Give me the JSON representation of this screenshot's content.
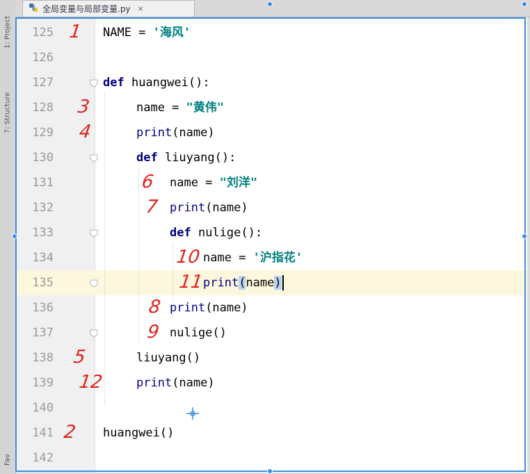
{
  "sidebar": {
    "project_tab": "1: Project",
    "structure_tab": "7: Structure",
    "favorites_tab": "Fav"
  },
  "tab": {
    "filename": "全局变量与局部变量.py",
    "close": "×"
  },
  "lines": [
    {
      "num": "125",
      "indent": 0,
      "parts": [
        [
          "NAME = ",
          "p"
        ],
        [
          "'海风'",
          "s"
        ]
      ],
      "anno": "1"
    },
    {
      "num": "126",
      "indent": 0,
      "parts": []
    },
    {
      "num": "127",
      "indent": 0,
      "parts": [
        [
          "def ",
          "k"
        ],
        [
          "huangwei",
          "p"
        ],
        [
          "():",
          "p"
        ]
      ],
      "fold": true
    },
    {
      "num": "128",
      "indent": 1,
      "parts": [
        [
          "name = ",
          "p"
        ],
        [
          "\"黄伟\"",
          "s"
        ]
      ],
      "anno": "3"
    },
    {
      "num": "129",
      "indent": 1,
      "parts": [
        [
          "print",
          "b"
        ],
        [
          "(name)",
          "p"
        ]
      ],
      "anno": "4"
    },
    {
      "num": "130",
      "indent": 1,
      "parts": [
        [
          "def ",
          "k"
        ],
        [
          "liuyang",
          "p"
        ],
        [
          "():",
          "p"
        ]
      ],
      "fold": true
    },
    {
      "num": "131",
      "indent": 2,
      "parts": [
        [
          "name = ",
          "p"
        ],
        [
          "\"刘洋\"",
          "s"
        ]
      ],
      "anno": "6"
    },
    {
      "num": "132",
      "indent": 2,
      "parts": [
        [
          "print",
          "b"
        ],
        [
          "(name)",
          "p"
        ]
      ],
      "anno": "7"
    },
    {
      "num": "133",
      "indent": 2,
      "parts": [
        [
          "def ",
          "k"
        ],
        [
          "nulige",
          "p"
        ],
        [
          "():",
          "p"
        ]
      ],
      "fold": true
    },
    {
      "num": "134",
      "indent": 3,
      "parts": [
        [
          "name = ",
          "p"
        ],
        [
          "'沪指花'",
          "s"
        ]
      ],
      "anno": "10"
    },
    {
      "num": "135",
      "indent": 3,
      "parts": [
        [
          "print",
          "b"
        ],
        [
          "(",
          "c"
        ],
        [
          "name",
          "p"
        ],
        [
          ")",
          "c"
        ]
      ],
      "anno": "11",
      "current": true,
      "fold": true
    },
    {
      "num": "136",
      "indent": 2,
      "parts": [
        [
          "print",
          "b"
        ],
        [
          "(name)",
          "p"
        ]
      ],
      "anno": "8"
    },
    {
      "num": "137",
      "indent": 2,
      "parts": [
        [
          "nulige()",
          "p"
        ]
      ],
      "anno": "9",
      "fold": true
    },
    {
      "num": "138",
      "indent": 1,
      "parts": [
        [
          "liuyang()",
          "p"
        ]
      ],
      "anno": "5"
    },
    {
      "num": "139",
      "indent": 1,
      "parts": [
        [
          "print",
          "b"
        ],
        [
          "(name)",
          "p"
        ]
      ],
      "anno": "12"
    },
    {
      "num": "140",
      "indent": 0,
      "parts": []
    },
    {
      "num": "141",
      "indent": 0,
      "parts": [
        [
          "huangwei()",
          "p"
        ]
      ],
      "anno": "2"
    },
    {
      "num": "142",
      "indent": 0,
      "parts": []
    }
  ],
  "colors": {
    "keyword": "#000080",
    "string": "#008080",
    "current_line": "#fdf8dd",
    "annotation": "#e0231c",
    "selection_frame": "#3b8ede"
  }
}
